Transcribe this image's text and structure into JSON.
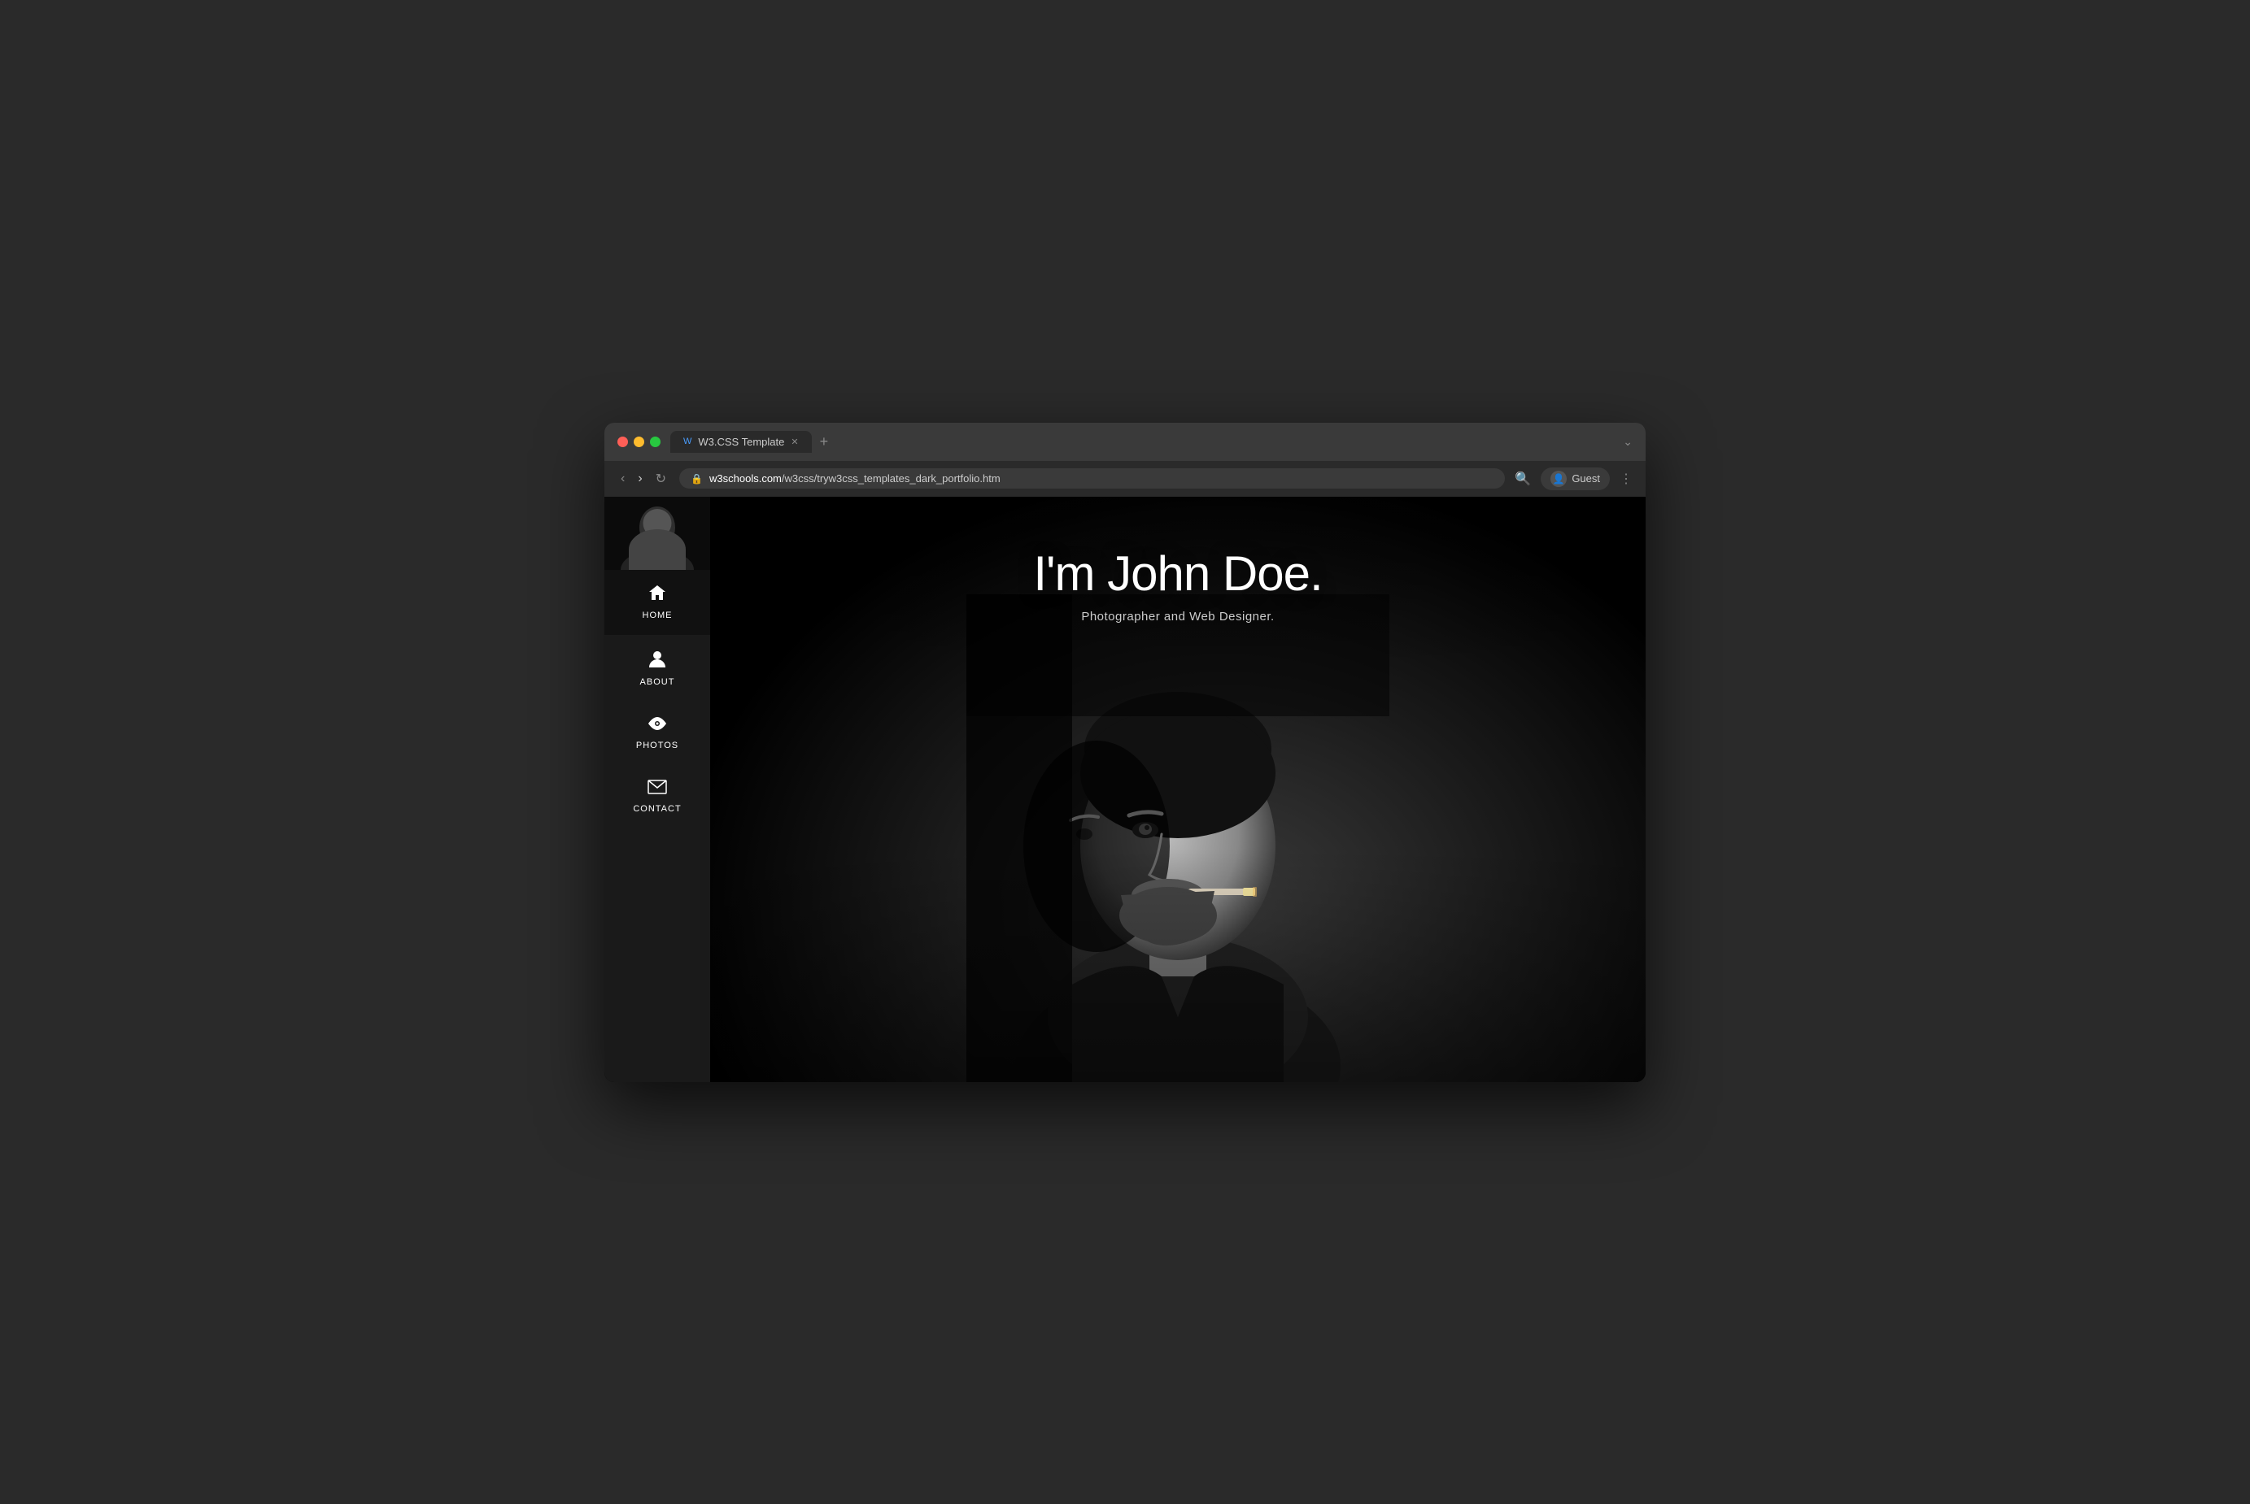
{
  "browser": {
    "tab_label": "W3.CSS Template",
    "url_protocol": "w3schools.com",
    "url_path": "/w3css/tryw3css_templates_dark_portfolio.htm",
    "tab_favicon": "W",
    "user_label": "Guest"
  },
  "sidebar": {
    "nav_items": [
      {
        "id": "home",
        "label": "HOME",
        "icon": "⌂"
      },
      {
        "id": "about",
        "label": "ABOUT",
        "icon": "👤"
      },
      {
        "id": "photos",
        "label": "PHOTOS",
        "icon": "👁"
      },
      {
        "id": "contact",
        "label": "CONTACT",
        "icon": "✉"
      }
    ]
  },
  "hero": {
    "name": "I'm John Doe.",
    "subtitle": "Photographer and Web Designer."
  },
  "colors": {
    "sidebar_bg": "#1a1a1a",
    "sidebar_active": "#111111",
    "main_bg": "#000000",
    "text_white": "#ffffff",
    "text_gray": "#cccccc"
  }
}
